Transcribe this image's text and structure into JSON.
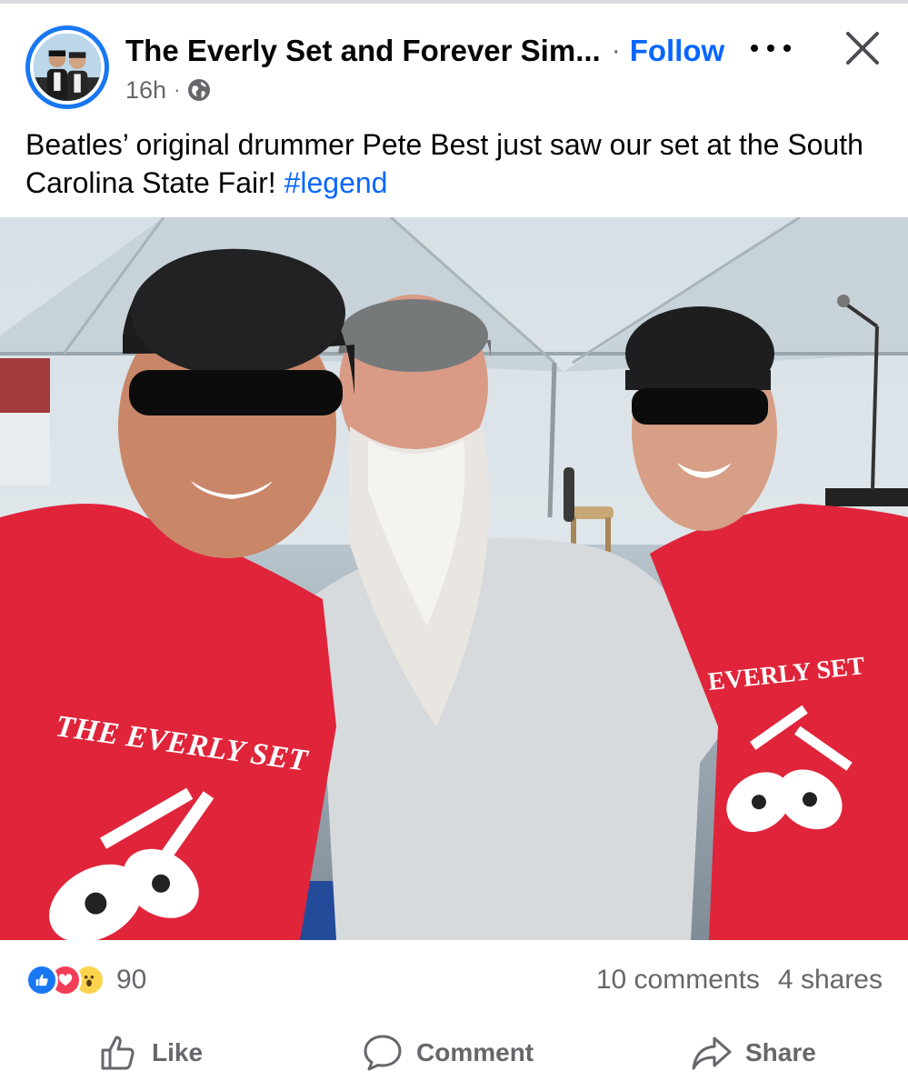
{
  "header": {
    "page_name": "The Everly Set and Forever Sim...",
    "separator": "·",
    "follow_label": "Follow",
    "time": "16h",
    "meta_separator": "·",
    "visibility_icon": "globe-icon",
    "more_icon": "more-options-icon",
    "close_icon": "close-icon"
  },
  "post": {
    "caption": "Beatles’ original drummer Pete Best just saw our set at the South Carolina State Fair!",
    "hashtag": "#legend",
    "photo": {
      "description_icon": "photo-three-men-tent",
      "shirt_text_left": "THE EVERLY SET",
      "shirt_text_right": "EVERLY SET"
    }
  },
  "engagement": {
    "reaction_icons": [
      "like-reaction-icon",
      "love-reaction-icon",
      "wow-reaction-icon"
    ],
    "reaction_count": "90",
    "comments": "10 comments",
    "shares": "4 shares"
  },
  "actions": {
    "like": "Like",
    "comment": "Comment",
    "share": "Share"
  },
  "colors": {
    "accent": "#0866ff",
    "secondary_text": "#65676b",
    "shirt_red": "#e0243a"
  }
}
